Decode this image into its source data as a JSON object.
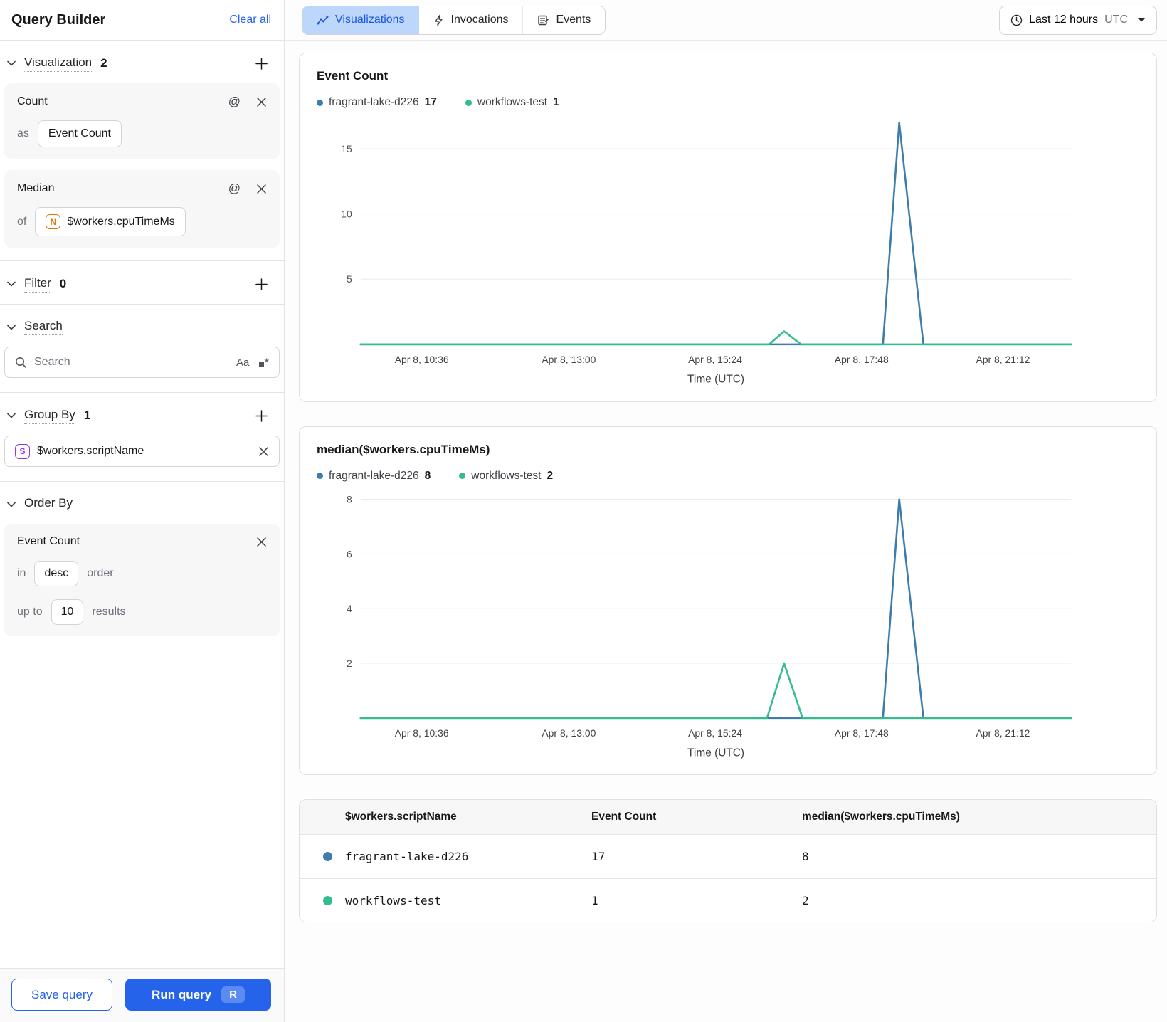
{
  "colors": {
    "blue": "#3d7dad",
    "green": "#31bd8c",
    "accent": "#2563eb",
    "tab_active_bg": "#bcd7fb",
    "tab_active_text": "#1a56db"
  },
  "sidebar": {
    "title": "Query Builder",
    "clear_all": "Clear all",
    "visualization": {
      "label": "Visualization",
      "count": "2",
      "cards": [
        {
          "title": "Count",
          "prefix": "as",
          "value": "Event Count"
        },
        {
          "title": "Median",
          "prefix": "of",
          "value": "$workers.cpuTimeMs",
          "value_type": "N"
        }
      ]
    },
    "filter": {
      "label": "Filter",
      "count": "0"
    },
    "search": {
      "label": "Search",
      "placeholder": "Search",
      "match_case": "Aa"
    },
    "group_by": {
      "label": "Group By",
      "count": "1",
      "items": [
        {
          "type": "S",
          "value": "$workers.scriptName"
        }
      ]
    },
    "order_by": {
      "label": "Order By",
      "card": {
        "title": "Event Count",
        "in_label": "in",
        "direction": "desc",
        "order_label": "order",
        "up_to_label": "up to",
        "limit": "10",
        "results_label": "results"
      }
    },
    "footer": {
      "save": "Save query",
      "run": "Run query",
      "run_shortcut": "R"
    }
  },
  "topbar": {
    "tabs": [
      {
        "label": "Visualizations",
        "active": true
      },
      {
        "label": "Invocations",
        "active": false
      },
      {
        "label": "Events",
        "active": false
      }
    ],
    "time_range": {
      "label": "Last 12 hours",
      "zone": "UTC"
    }
  },
  "chart_data": [
    {
      "type": "line",
      "title": "Event Count",
      "xlabel": "Time (UTC)",
      "legend": [
        {
          "name": "fragrant-lake-d226",
          "value": "17",
          "color": "#3d7dad"
        },
        {
          "name": "workflows-test",
          "value": "1",
          "color": "#31bd8c"
        }
      ],
      "y_ticks": [
        5,
        10,
        15
      ],
      "y_domain_max": 17.4,
      "x_ticks": [
        {
          "label": "Apr 8, 10:36",
          "f": 0.086
        },
        {
          "label": "Apr 8, 13:00",
          "f": 0.293
        },
        {
          "label": "Apr 8, 15:24",
          "f": 0.499
        },
        {
          "label": "Apr 8, 17:48",
          "f": 0.705
        },
        {
          "label": "Apr 8, 21:12",
          "f": 0.904
        }
      ],
      "series": [
        {
          "name": "fragrant-lake-d226",
          "color": "#3d7dad",
          "points": [
            [
              0,
              0
            ],
            [
              0.735,
              0
            ],
            [
              0.758,
              17
            ],
            [
              0.792,
              0
            ],
            [
              1,
              0
            ]
          ]
        },
        {
          "name": "workflows-test",
          "color": "#31bd8c",
          "points": [
            [
              0,
              0
            ],
            [
              0.575,
              0
            ],
            [
              0.596,
              1
            ],
            [
              0.62,
              0
            ],
            [
              1,
              0
            ]
          ]
        }
      ]
    },
    {
      "type": "line",
      "title": "median($workers.cpuTimeMs)",
      "xlabel": "Time (UTC)",
      "legend": [
        {
          "name": "fragrant-lake-d226",
          "value": "8",
          "color": "#3d7dad"
        },
        {
          "name": "workflows-test",
          "value": "2",
          "color": "#31bd8c"
        }
      ],
      "y_ticks": [
        2,
        4,
        6,
        8
      ],
      "y_domain_max": 8.3,
      "x_ticks": [
        {
          "label": "Apr 8, 10:36",
          "f": 0.086
        },
        {
          "label": "Apr 8, 13:00",
          "f": 0.293
        },
        {
          "label": "Apr 8, 15:24",
          "f": 0.499
        },
        {
          "label": "Apr 8, 17:48",
          "f": 0.705
        },
        {
          "label": "Apr 8, 21:12",
          "f": 0.904
        }
      ],
      "series": [
        {
          "name": "fragrant-lake-d226",
          "color": "#3d7dad",
          "points": [
            [
              0,
              0
            ],
            [
              0.735,
              0
            ],
            [
              0.758,
              8
            ],
            [
              0.792,
              0
            ],
            [
              1,
              0
            ]
          ]
        },
        {
          "name": "workflows-test",
          "color": "#31bd8c",
          "points": [
            [
              0,
              0
            ],
            [
              0.572,
              0
            ],
            [
              0.596,
              2
            ],
            [
              0.622,
              0
            ],
            [
              1,
              0
            ]
          ]
        }
      ]
    }
  ],
  "table": {
    "columns": [
      "$workers.scriptName",
      "Event Count",
      "median($workers.cpuTimeMs)"
    ],
    "rows": [
      {
        "color": "#3d7dad",
        "name": "fragrant-lake-d226",
        "event_count": "17",
        "median": "8"
      },
      {
        "color": "#31bd8c",
        "name": "workflows-test",
        "event_count": "1",
        "median": "2"
      }
    ]
  }
}
